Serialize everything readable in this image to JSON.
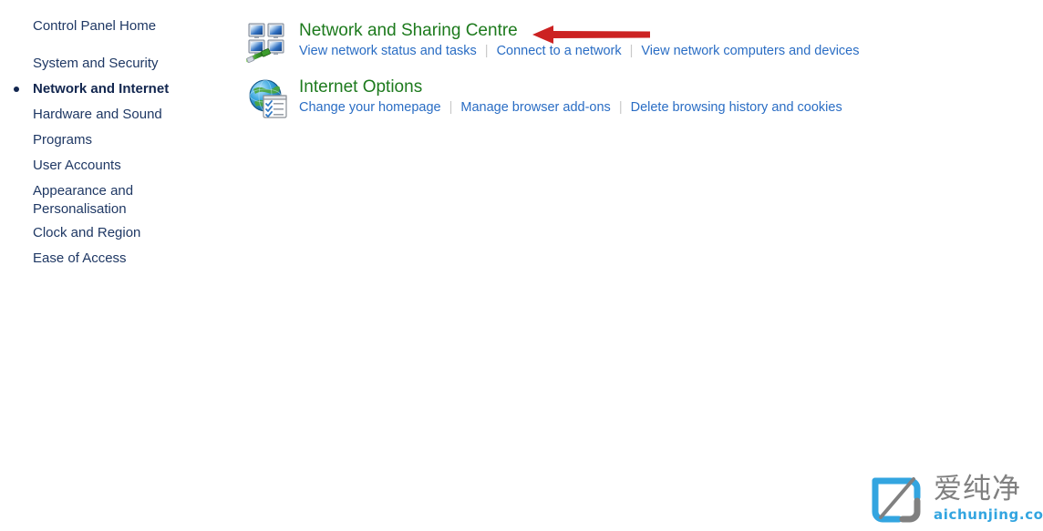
{
  "page": {
    "background_color": "#ffffff",
    "link_color": "#2a6dc4",
    "heading_color": "#1d7a1d",
    "sidebar_text_color": "#1f3864",
    "arrow_color": "#cc2222"
  },
  "sidebar": {
    "items": [
      {
        "label": "Control Panel Home",
        "active": false
      },
      {
        "label": "System and Security",
        "active": false
      },
      {
        "label": "Network and Internet",
        "active": true
      },
      {
        "label": "Hardware and Sound",
        "active": false
      },
      {
        "label": "Programs",
        "active": false
      },
      {
        "label": "User Accounts",
        "active": false
      },
      {
        "label": "Appearance and Personalisation",
        "active": false
      },
      {
        "label": "Clock and Region",
        "active": false
      },
      {
        "label": "Ease of Access",
        "active": false
      }
    ]
  },
  "main": {
    "sections": [
      {
        "icon": "network-sharing-icon",
        "title": "Network and Sharing Centre",
        "links": [
          "View network status and tasks",
          "Connect to a network",
          "View network computers and devices"
        ]
      },
      {
        "icon": "internet-options-icon",
        "title": "Internet Options",
        "links": [
          "Change your homepage",
          "Manage browser add-ons",
          "Delete browsing history and cookies"
        ]
      }
    ]
  },
  "annotation": {
    "type": "arrow",
    "direction": "left",
    "color": "#cc2222",
    "points_at": "Network and Sharing Centre"
  },
  "watermark": {
    "logo_name": "aichunjing-logo",
    "brand_cn": "爱纯净",
    "domain": "aichunjing.com",
    "brand_color": "#808080",
    "domain_color": "#33a5e0",
    "logo_color": "#33a5e0"
  }
}
